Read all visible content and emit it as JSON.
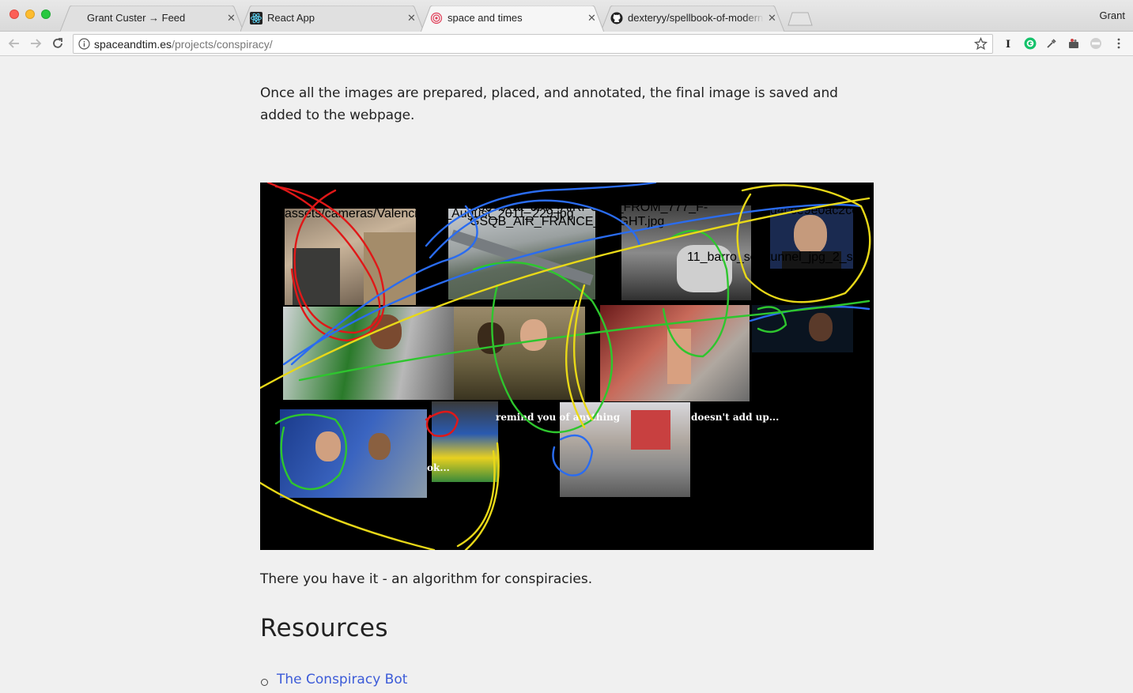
{
  "browser": {
    "tabs": [
      {
        "label": "Grant Custer → Feed",
        "active": false,
        "icon": "none"
      },
      {
        "label": "React App",
        "active": false,
        "icon": "react-icon"
      },
      {
        "label": "space and times",
        "active": true,
        "icon": "target-icon"
      },
      {
        "label": "dexteryy/spellbook-of-modern",
        "active": false,
        "icon": "github-icon"
      }
    ],
    "profile_name": "Grant",
    "url_host": "spaceandtim.es",
    "url_path": "/projects/conspiracy/"
  },
  "article": {
    "intro_text": "Once all the images are prepared, placed, and annotated, the final image is saved and added to the webpage.",
    "outro_text": "There you have it - an algorithm for conspiracies.",
    "resources_heading": "Resources",
    "resources": [
      {
        "label": "The Conspiracy Bot"
      }
    ],
    "collage": {
      "overlay_texts": [
        "remind you of anything",
        "doesn't add up...",
        "ok..."
      ],
      "colors": {
        "red": "#e01818",
        "blue": "#2a6cf0",
        "green": "#2ec62e",
        "yellow": "#e8d818"
      }
    }
  },
  "colors": {
    "link": "#3c5bd8",
    "text": "#222222",
    "page_bg": "#f0f0f0"
  }
}
